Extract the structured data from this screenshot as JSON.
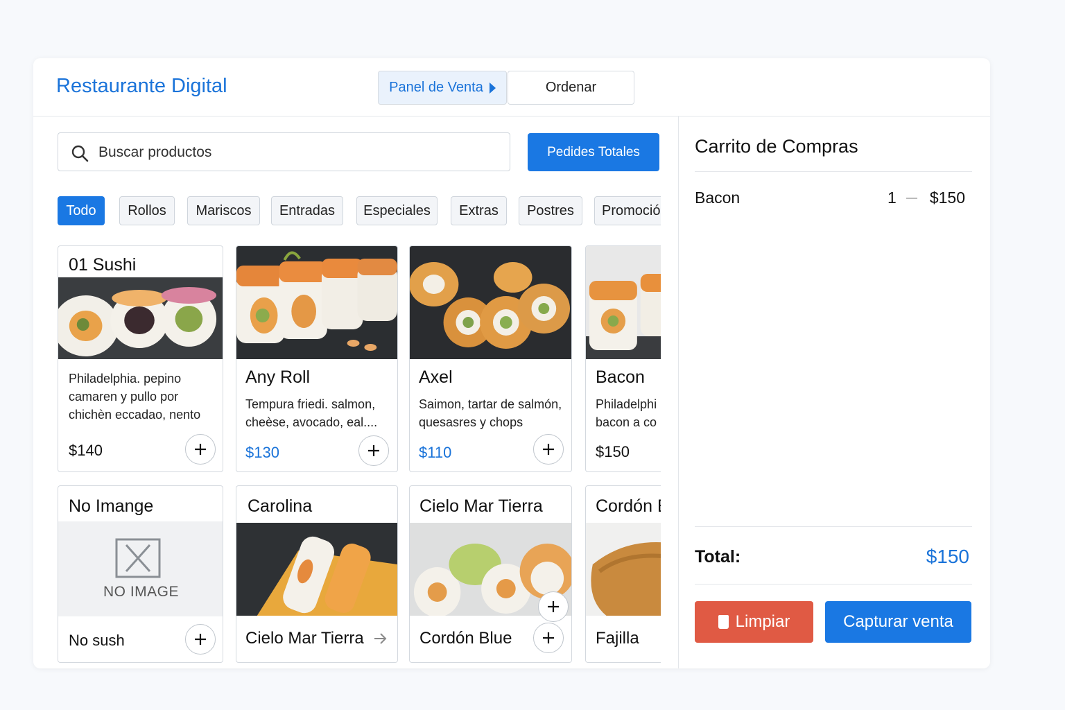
{
  "app": {
    "title": "Restaurante Digital"
  },
  "nav": {
    "panel_venta": "Panel de Venta",
    "ordenar": "Ordenar"
  },
  "search": {
    "placeholder": "Buscar productos",
    "icon": "search-icon"
  },
  "pedidos_label": "Pedides Totales",
  "categories": [
    {
      "label": "Todo",
      "active": true
    },
    {
      "label": "Rollos"
    },
    {
      "label": "Mariscos"
    },
    {
      "label": "Entradas"
    },
    {
      "label": "Especiales"
    },
    {
      "label": "Extras"
    },
    {
      "label": "Postres"
    },
    {
      "label": "Promoción"
    }
  ],
  "products": [
    {
      "title": "01 Sushi",
      "desc1": "Philadelphia. pepino",
      "desc2": "camaren y pullo por",
      "desc3": "chichèn eccadao, nento",
      "price": "$140"
    },
    {
      "title": "Any Roll",
      "desc1": "Tempura friedi. salmon,",
      "desc2": "cheèse, avocado, eal....",
      "price": "$130"
    },
    {
      "title": "Axel",
      "desc1": "Saimon, tartar de salmón,",
      "desc2": "quesasres y chops",
      "price": "$110"
    },
    {
      "title": "Bacon",
      "desc1": "Philadelphi",
      "desc2": "bacon a co",
      "price": "$150"
    },
    {
      "title": "No Imange",
      "no_image_text": "NO IMAGE",
      "footer": "No sush"
    },
    {
      "title": "Carolina",
      "footer": "Cielo Mar Tierra"
    },
    {
      "title": "Cielo Mar Tierra",
      "footer": "Cordón Blue"
    },
    {
      "title": "Cordón Blue",
      "footer": "Fajilla"
    }
  ],
  "cart": {
    "title": "Carrito de Compras",
    "items": [
      {
        "name": "Bacon",
        "qty": "1",
        "amount": "$150"
      }
    ],
    "total_label": "Total:",
    "total_value": "$150",
    "clear_label": "Limpiar",
    "capture_label": "Capturar venta"
  },
  "colors": {
    "accent": "#1a78e3",
    "danger": "#e05a44"
  }
}
